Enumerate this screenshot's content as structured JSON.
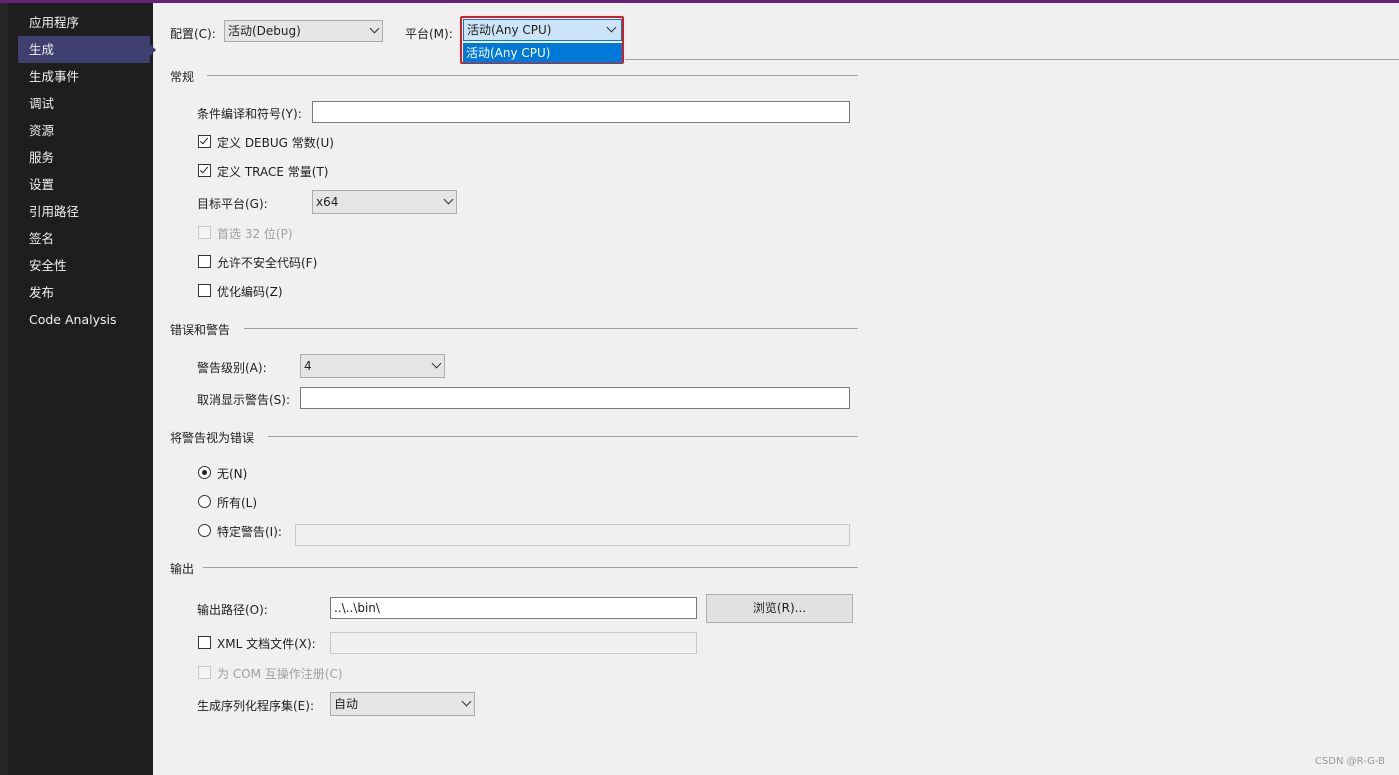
{
  "sidebar": {
    "items": [
      "应用程序",
      "生成",
      "生成事件",
      "调试",
      "资源",
      "服务",
      "设置",
      "引用路径",
      "签名",
      "安全性",
      "发布",
      "Code Analysis"
    ],
    "active": "生成"
  },
  "header": {
    "config_label": "配置(C):",
    "config_value": "活动(Debug)",
    "platform_label": "平台(M):",
    "platform_value": "活动(Any CPU)",
    "platform_options": [
      "活动(Any CPU)"
    ]
  },
  "general": {
    "title": "常规",
    "conditional_symbols_label": "条件编译和符号(Y):",
    "conditional_symbols_value": "",
    "define_debug_label": "定义 DEBUG 常数(U)",
    "define_debug_checked": true,
    "define_trace_label": "定义 TRACE 常量(T)",
    "define_trace_checked": true,
    "target_platform_label": "目标平台(G):",
    "target_platform_value": "x64",
    "prefer32_label": "首选 32 位(P)",
    "unsafe_label": "允许不安全代码(F)",
    "optimize_label": "优化编码(Z)"
  },
  "errors": {
    "title": "错误和警告",
    "warning_level_label": "警告级别(A):",
    "warning_level_value": "4",
    "suppress_label": "取消显示警告(S):",
    "suppress_value": ""
  },
  "treat_warnings": {
    "title": "将警告视为错误",
    "none_label": "无(N)",
    "all_label": "所有(L)",
    "specific_label": "特定警告(I):",
    "selected": "none"
  },
  "output": {
    "title": "输出",
    "path_label": "输出路径(O):",
    "path_value": "..\\..\\bin\\",
    "browse_label": "浏览(R)...",
    "xml_doc_label": "XML 文档文件(X):",
    "com_label": "为 COM 互操作注册(C)",
    "serialization_label": "生成序列化程序集(E):",
    "serialization_value": "自动"
  },
  "watermark": "CSDN @R-G-B"
}
